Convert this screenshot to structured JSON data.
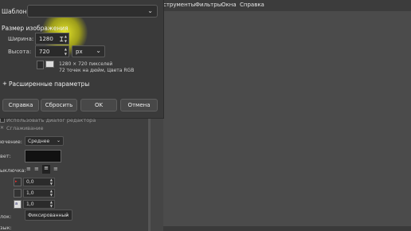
{
  "menubar": {
    "items": [
      "струменты",
      "Фильтры",
      "Окна",
      "Справка"
    ]
  },
  "dialog": {
    "template_label": "Шаблон:",
    "template_value": "",
    "size_section_title": "Размер изображения",
    "width_label": "Ширина:",
    "width_value": "1280",
    "height_label": "Высота:",
    "height_value": "720",
    "unit_value": "px",
    "info_line1": "1280 × 720 пикселей",
    "info_line2": "72 точек на дюйм, Цвета RGB",
    "advanced_label": "Расширенные параметры",
    "buttons": {
      "help": "Справка",
      "reset": "Сбросить",
      "ok": "OK",
      "cancel": "Отмена"
    }
  },
  "tool_options": {
    "use_editor_dialog": "Использовать диалог редактора",
    "antialiasing": "Сглаживание",
    "hinting_label": "ючение:",
    "hinting_value": "Среднее",
    "color_label": "вет:",
    "justify_label": "ыключка:",
    "indent_value": "0,0",
    "line_spacing_value": "1,0",
    "letter_spacing_value": "1,0",
    "box_label": "лок:",
    "box_value": "Фиксированный",
    "language_label": "зык:"
  },
  "colors": {
    "highlight": "#f0f000",
    "text_color_swatch": "#111111"
  }
}
